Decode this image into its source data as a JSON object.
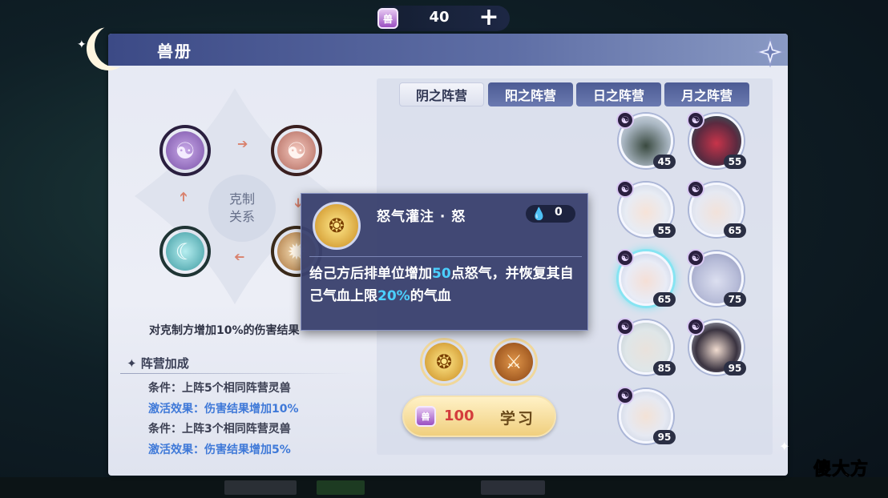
{
  "currency": {
    "value": "40",
    "badge": "兽",
    "plus_label": "+"
  },
  "panel": {
    "title": "兽册"
  },
  "counter": {
    "center_label_1": "克制",
    "center_label_2": "关系",
    "effect_text": "对克制方增加10%的伤害结果"
  },
  "bonus": {
    "title": "阵营加成",
    "lines": [
      {
        "text": "条件：上阵5个相同阵营灵兽",
        "kind": "condition"
      },
      {
        "text": "激活效果：伤害结果增加10%",
        "kind": "effect"
      },
      {
        "text": "条件：上阵3个相同阵营灵兽",
        "kind": "condition"
      },
      {
        "text": "激活效果：伤害结果增加5%",
        "kind": "effect"
      }
    ]
  },
  "tabs": [
    {
      "label": "阴之阵营",
      "active": true
    },
    {
      "label": "阳之阵营",
      "active": false
    },
    {
      "label": "日之阵营",
      "active": false
    },
    {
      "label": "月之阵营",
      "active": false
    }
  ],
  "beasts": [
    {
      "level": "45",
      "icon": "masked-hat-beast-portrait"
    },
    {
      "level": "55",
      "icon": "red-demon-beast-portrait"
    },
    {
      "level": "55",
      "icon": "white-hair-lady-portrait"
    },
    {
      "level": "65",
      "icon": "white-hair-fox-portrait"
    },
    {
      "level": "65",
      "icon": "silver-hair-maiden-portrait",
      "selected": true
    },
    {
      "level": "75",
      "icon": "horned-white-beast-portrait"
    },
    {
      "level": "85",
      "icon": "veiled-white-beast-portrait"
    },
    {
      "level": "95",
      "icon": "black-hair-lady-portrait"
    },
    {
      "level": "95",
      "icon": "bald-monk-portrait"
    }
  ],
  "popup": {
    "skill_name": "怒气灌注 · 怒",
    "cost": "0",
    "desc_1": "给己方后排单位增加",
    "desc_hl1": "50",
    "desc_2": "点怒气，并恢复其自己气血上限",
    "desc_hl2": "20%",
    "desc_3": "的气血",
    "highlight_color": "#4bd0ff"
  },
  "skills": [
    {
      "icon": "golden-rage-skill-icon"
    },
    {
      "icon": "crossed-swords-skill-icon"
    }
  ],
  "learn": {
    "badge": "兽",
    "cost": "100",
    "label": "学习"
  },
  "watermark": {
    "part1": "傻",
    "part2": "大方"
  },
  "colors": {
    "accent": "#4c5b94",
    "effect_text": "#3f79d8",
    "cost_red": "#d43c3c"
  }
}
